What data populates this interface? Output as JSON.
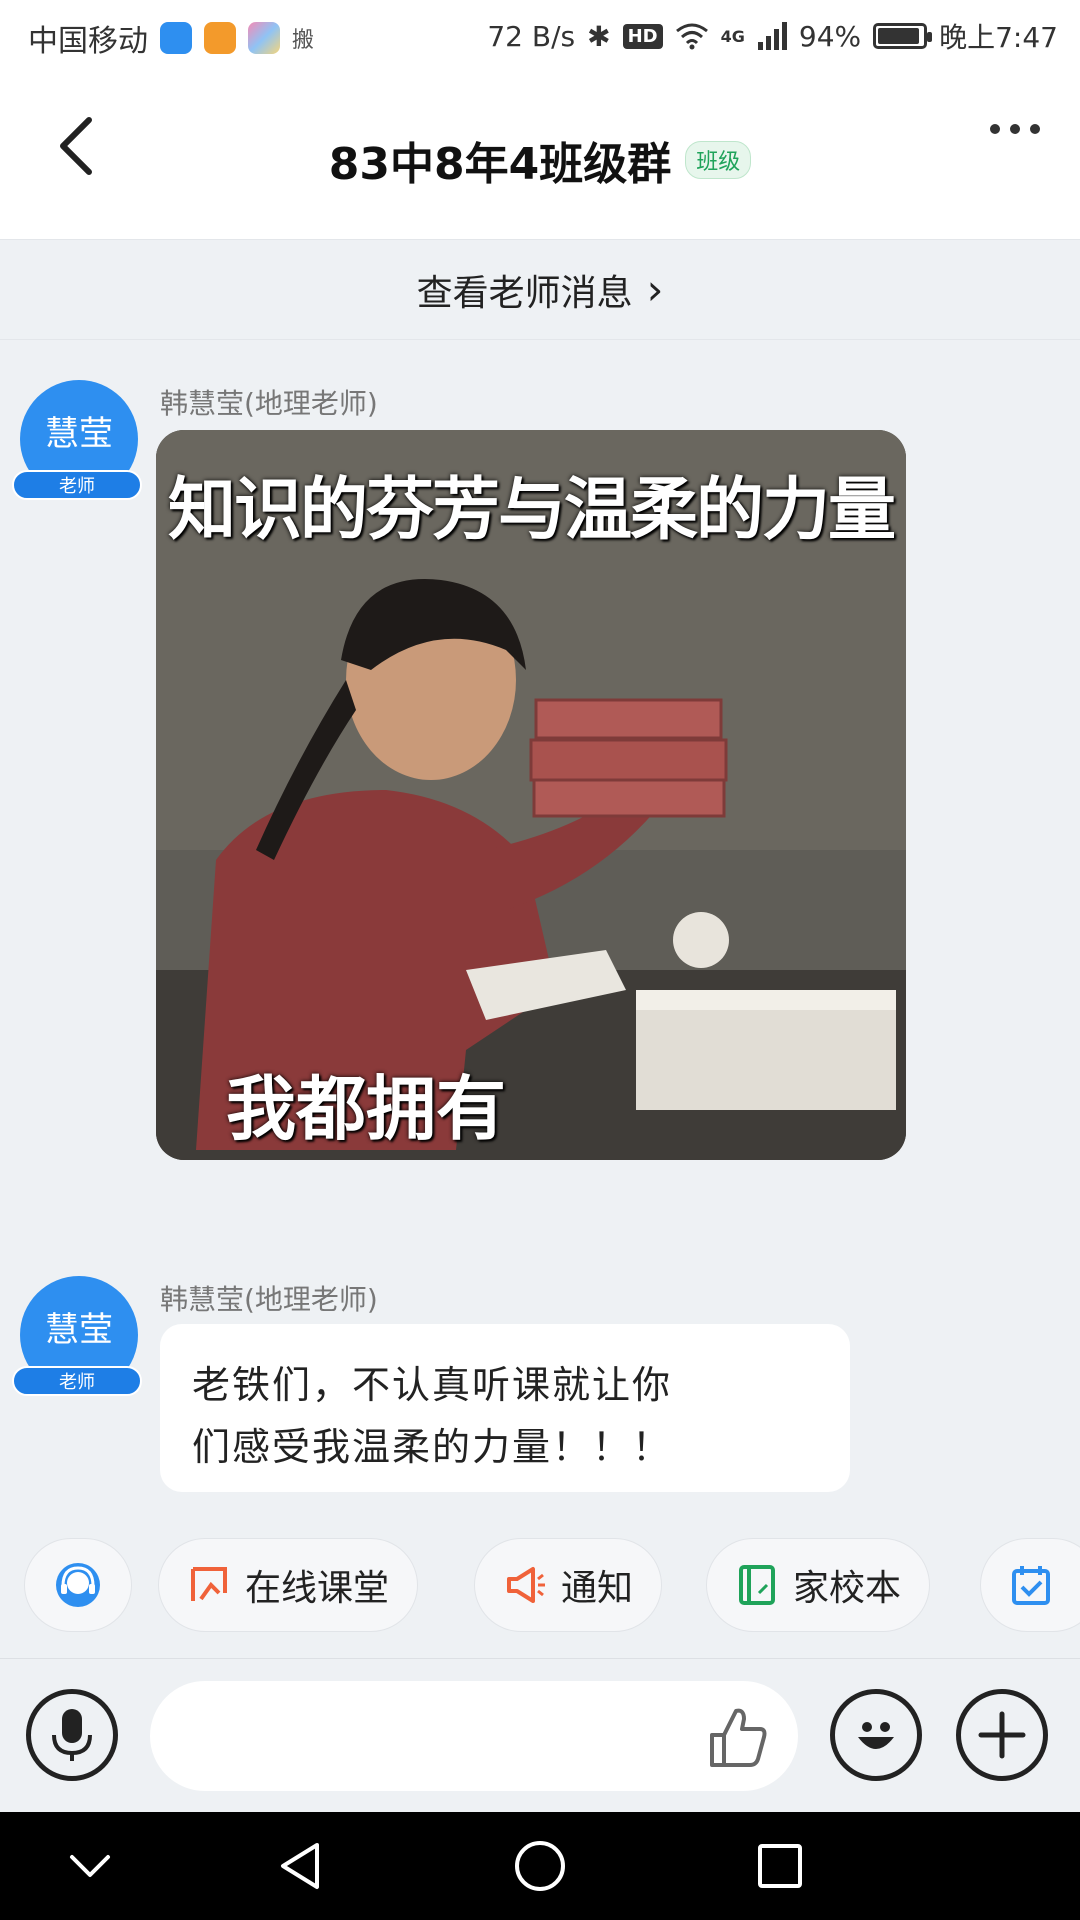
{
  "status_bar": {
    "carrier": "中国移动",
    "extra": "搬",
    "speed": "72 B/s",
    "network": "4G",
    "battery": "94%",
    "battery_level": 0.94,
    "time": "晚上7:47"
  },
  "header": {
    "title": "83中8年4班级群",
    "tag": "班级"
  },
  "teacher_link": {
    "label": "查看老师消息",
    "chevron": "›"
  },
  "messages": [
    {
      "sender": "韩慧莹(地理老师)",
      "avatar_text": "慧莹",
      "avatar_role": "老师",
      "image": {
        "top_caption": "知识的芬芳与温柔的力量",
        "bottom_caption": "我都拥有"
      }
    },
    {
      "sender": "韩慧莹(地理老师)",
      "avatar_text": "慧莹",
      "avatar_role": "老师",
      "text_line1": "老铁们，不认真听课就让你",
      "text_line2": "们感受我温柔的力量！！！"
    }
  ],
  "quick_actions": [
    {
      "icon": "headset-icon",
      "label": ""
    },
    {
      "icon": "online-class-icon",
      "label": "在线课堂",
      "color": "#f0623a"
    },
    {
      "icon": "megaphone-icon",
      "label": "通知",
      "color": "#f0623a"
    },
    {
      "icon": "notebook-icon",
      "label": "家校本",
      "color": "#1fa35a"
    },
    {
      "icon": "calendar-icon",
      "label": "",
      "color": "#2e8ff0"
    }
  ],
  "input_bar": {
    "placeholder": ""
  },
  "colors": {
    "accent_blue": "#2e8ff0",
    "tag_green": "#1fa35a",
    "action_orange": "#f0623a",
    "background": "#eef1f4"
  }
}
